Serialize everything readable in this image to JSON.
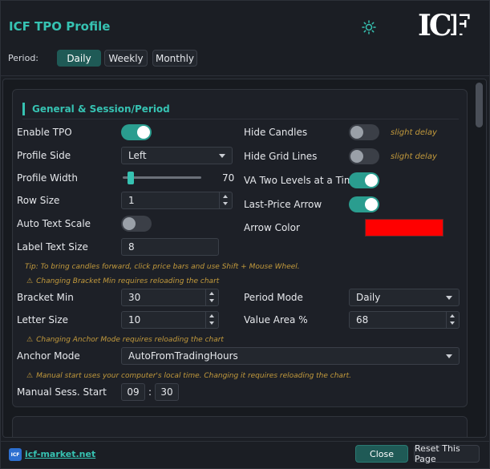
{
  "header": {
    "title": "ICF TPO Profile",
    "theme_icon": "sun-icon",
    "logo_text": "ICF",
    "period_label": "Period:",
    "period_buttons": [
      {
        "label": "Daily",
        "active": true
      },
      {
        "label": "Weekly",
        "active": false
      },
      {
        "label": "Monthly",
        "active": false
      }
    ]
  },
  "section": {
    "title": "General & Session/Period"
  },
  "left": {
    "enable_tpo": {
      "label": "Enable TPO",
      "on": true
    },
    "profile_side": {
      "label": "Profile Side",
      "value": "Left"
    },
    "profile_width": {
      "label": "Profile Width",
      "value": "70",
      "fraction": 0.07
    },
    "row_size": {
      "label": "Row Size",
      "value": "1"
    },
    "auto_text_scale": {
      "label": "Auto Text Scale",
      "on": false
    },
    "label_text_size": {
      "label": "Label Text Size",
      "value": "8"
    },
    "bracket_min": {
      "label": "Bracket Min",
      "value": "30"
    },
    "letter_size": {
      "label": "Letter Size",
      "value": "10"
    },
    "anchor_mode": {
      "label": "Anchor Mode",
      "value": "AutoFromTradingHours"
    },
    "manual_start": {
      "label": "Manual Sess. Start",
      "hour": "09",
      "minute": "30",
      "separator": ":"
    }
  },
  "right": {
    "hide_candles": {
      "label": "Hide Candles",
      "on": false,
      "hint": "slight delay"
    },
    "hide_grid": {
      "label": "Hide Grid Lines",
      "on": false,
      "hint": "slight delay"
    },
    "va_two_levels": {
      "label": "VA Two Levels at a Time",
      "on": true
    },
    "last_price_arrow": {
      "label": "Last-Price Arrow",
      "on": true
    },
    "arrow_color": {
      "label": "Arrow Color",
      "color": "#ff0000"
    },
    "period_mode": {
      "label": "Period Mode",
      "value": "Daily"
    },
    "value_area": {
      "label": "Value Area %",
      "value": "68"
    }
  },
  "notes": {
    "tip": "Tip: To bring candles forward, click price bars and use Shift + Mouse Wheel.",
    "bracket_warning": "Changing Bracket Min requires reloading the chart",
    "anchor_warning": "Changing Anchor Mode requires reloading the chart",
    "manual_warning": "Manual start uses your computer's local time. Changing it requires reloading the chart.",
    "warning_icon": "⚠"
  },
  "footer": {
    "logo_text": "ICF",
    "link": "icf-market.net",
    "close_label": "Close",
    "reset_label": "Reset This Page"
  },
  "colors": {
    "accent": "#36c2b2",
    "toggle_on": "#2a9d8f",
    "warning": "#c39a3c",
    "background": "#1b1e24"
  }
}
